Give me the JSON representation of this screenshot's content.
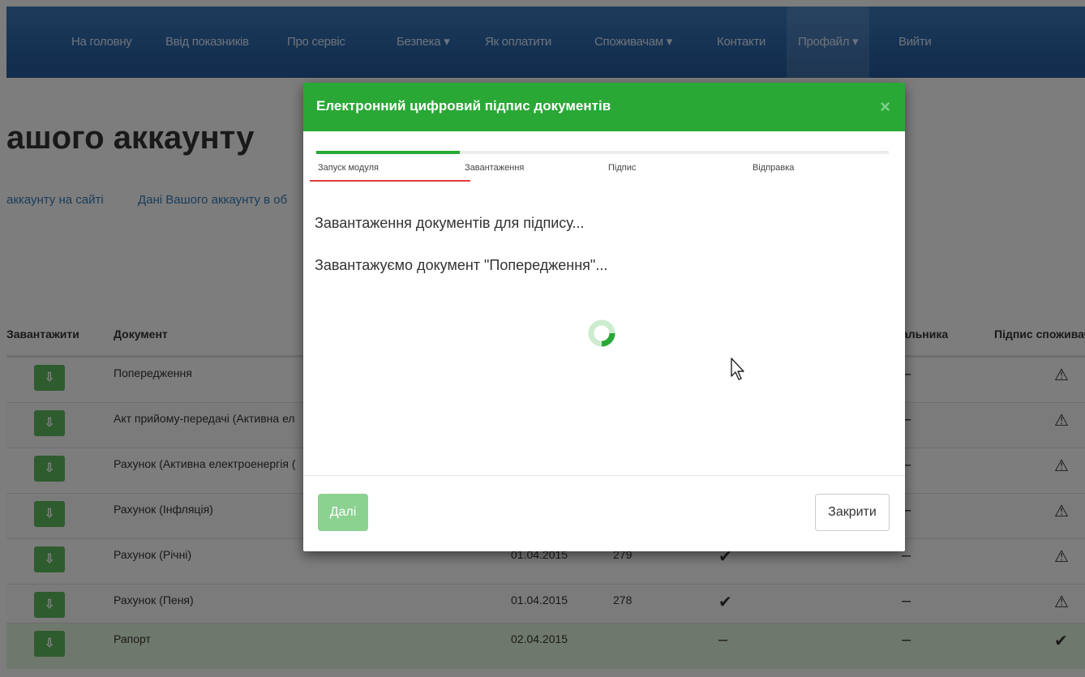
{
  "navbar": {
    "items": [
      "На головну",
      "Ввід показників",
      "Про сервіс",
      "Безпека ▾",
      "Як оплатити",
      "Споживачам ▾",
      "Контакти",
      "Профайл ▾",
      "Вийти"
    ]
  },
  "page": {
    "heading": "ашого аккаунту",
    "links": [
      "аккаунту на сайті",
      "Дані Вашого аккаунту в об"
    ]
  },
  "table": {
    "headers": [
      "Завантажити",
      "Документ",
      "альника",
      "Підпис споживача"
    ],
    "rows": [
      {
        "doc": "Попередження",
        "date": "",
        "num": "",
        "c1": "",
        "c2": "–",
        "c3": "⚠"
      },
      {
        "doc": "Акт прийому-передачі (Активна ел",
        "date": "",
        "num": "",
        "c1": "",
        "c2": "–",
        "c3": "⚠"
      },
      {
        "doc": "Рахунок (Активна електроенергія (",
        "date": "",
        "num": "",
        "c1": "",
        "c2": "–",
        "c3": "⚠"
      },
      {
        "doc": "Рахунок (Інфляція)",
        "date": "",
        "num": "",
        "c1": "",
        "c2": "–",
        "c3": "⚠"
      },
      {
        "doc": "Рахунок (Річні)",
        "date": "01.04.2015",
        "num": "279",
        "c1": "✔",
        "c2": "–",
        "c3": "⚠"
      },
      {
        "doc": "Рахунок (Пеня)",
        "date": "01.04.2015",
        "num": "278",
        "c1": "✔",
        "c2": "–",
        "c3": "⚠"
      },
      {
        "doc": "Рапорт",
        "date": "02.04.2015",
        "num": "",
        "c1": "–",
        "c2": "–",
        "c3": "✔"
      }
    ],
    "download_glyph": "⇩"
  },
  "modal": {
    "title": "Електронний цифровий підпис документів",
    "close_glyph": "×",
    "progress_fraction": 0.25,
    "steps": [
      "Запуск модуля",
      "Завантаження",
      "Підпис",
      "Відправка"
    ],
    "messages": [
      "Завантаження документів для підпису...",
      "Завантажуємо документ \"Попередження\"..."
    ],
    "next_label": "Далі",
    "close_label": "Закрити"
  },
  "colors": {
    "navbar": "#2a63a6",
    "modal_header": "#2aa836",
    "progress": "#2aa836",
    "link": "#337ab7",
    "next_button": "#8bd190",
    "red_underline": "#e03a3a"
  }
}
